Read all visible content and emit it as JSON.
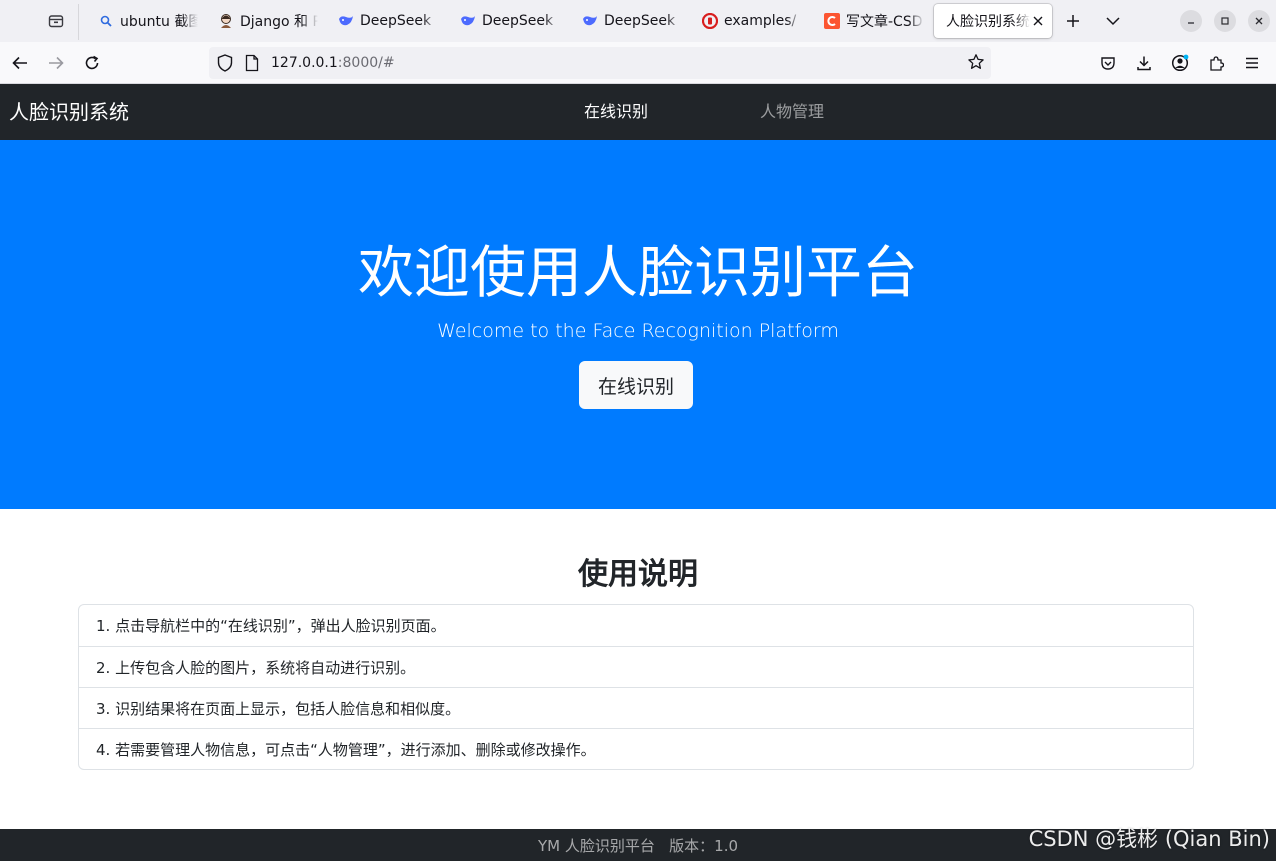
{
  "browser": {
    "tabs": [
      {
        "title": "ubuntu 截图",
        "favicon": "search-icon"
      },
      {
        "title": "Django 和 Python",
        "favicon": "avatar-icon"
      },
      {
        "title": "DeepSeek",
        "favicon": "deepseek-whale-icon"
      },
      {
        "title": "DeepSeek",
        "favicon": "deepseek-whale-icon"
      },
      {
        "title": "DeepSeek",
        "favicon": "deepseek-whale-icon"
      },
      {
        "title": "examples/",
        "favicon": "red-circle-logo-icon"
      },
      {
        "title": "写文章-CSDN",
        "favicon": "csdn-icon"
      },
      {
        "title": "人脸识别系统",
        "favicon": "none",
        "active": true
      }
    ],
    "url": {
      "host": "127.0.0.1",
      "rest": ":8000/#"
    },
    "colors": {
      "tabstrip": "#f0f0f4",
      "toolbar": "#f9f9fb",
      "urlbar": "#f0f0f4"
    }
  },
  "site": {
    "brand": "人脸识别系统",
    "nav": {
      "online": "在线识别",
      "people": "人物管理"
    }
  },
  "hero": {
    "title": "欢迎使用人脸识别平台",
    "subtitle": "Welcome to the Face Recognition Platform",
    "button": "在线识别"
  },
  "instructions": {
    "title": "使用说明",
    "items": [
      "1. 点击导航栏中的“在线识别”，弹出人脸识别页面。",
      "2. 上传包含人脸的图片，系统将自动进行识别。",
      "3. 识别结果将在页面上显示，包括人脸信息和相似度。",
      "4. 若需要管理人物信息，可点击“人物管理”，进行添加、删除或修改操作。"
    ]
  },
  "footer": {
    "text": "YM 人脸识别平台   版本：1.0"
  },
  "watermark": "CSDN @钱彬 (Qian Bin)",
  "colors": {
    "header": "#212529",
    "hero": "#007bff",
    "footer": "#212529",
    "accent_csdn": "#fc5531"
  }
}
